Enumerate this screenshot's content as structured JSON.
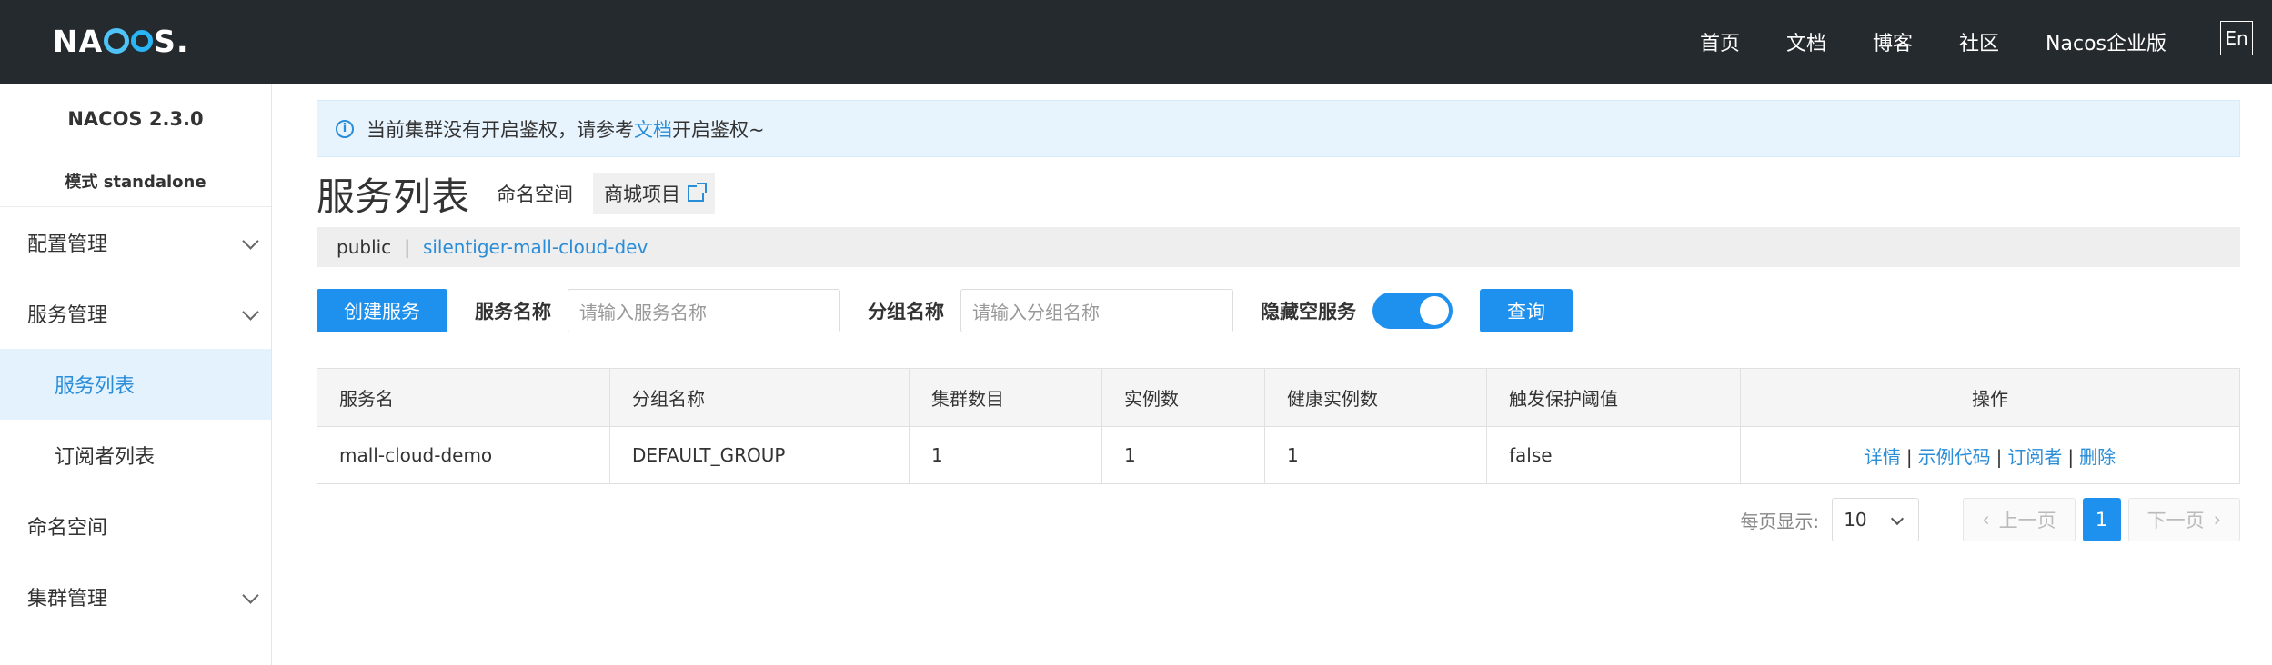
{
  "header": {
    "logo_text": "NACOS.",
    "nav": [
      "首页",
      "文档",
      "博客",
      "社区",
      "Nacos企业版"
    ],
    "lang": "En"
  },
  "sidebar": {
    "version": "NACOS 2.3.0",
    "mode": "模式 standalone",
    "items": [
      {
        "label": "配置管理",
        "expandable": true
      },
      {
        "label": "服务管理",
        "expandable": true
      },
      {
        "label": "服务列表",
        "sub": true,
        "active": true
      },
      {
        "label": "订阅者列表",
        "sub": true
      },
      {
        "label": "命名空间",
        "expandable": false
      },
      {
        "label": "集群管理",
        "expandable": true
      }
    ]
  },
  "notice": {
    "text_before": "当前集群没有开启鉴权，请参考",
    "link": "文档",
    "text_after": "开启鉴权~"
  },
  "page": {
    "title": "服务列表",
    "namespace_label": "命名空间",
    "namespace_badge": "商城项目"
  },
  "ns_bar": {
    "public": "public",
    "separator": "|",
    "namespace": "silentiger-mall-cloud-dev"
  },
  "filters": {
    "create_button": "创建服务",
    "service_name_label": "服务名称",
    "service_name_placeholder": "请输入服务名称",
    "group_name_label": "分组名称",
    "group_name_placeholder": "请输入分组名称",
    "hide_empty_label": "隐藏空服务",
    "hide_empty_on": true,
    "query_button": "查询"
  },
  "table": {
    "columns": [
      "服务名",
      "分组名称",
      "集群数目",
      "实例数",
      "健康实例数",
      "触发保护阈值",
      "操作"
    ],
    "rows": [
      {
        "service": "mall-cloud-demo",
        "group": "DEFAULT_GROUP",
        "clusters": "1",
        "instances": "1",
        "healthy": "1",
        "protect": "false"
      }
    ],
    "actions": [
      "详情",
      "示例代码",
      "订阅者",
      "删除"
    ]
  },
  "pagination": {
    "page_size_label": "每页显示:",
    "page_size": "10",
    "prev": "上一页",
    "current": "1",
    "next": "下一页"
  },
  "colors": {
    "header_bg": "#252a2f",
    "primary": "#1e90ee",
    "link": "#2a8dd8",
    "active_menu_bg": "#e3f2fd"
  }
}
